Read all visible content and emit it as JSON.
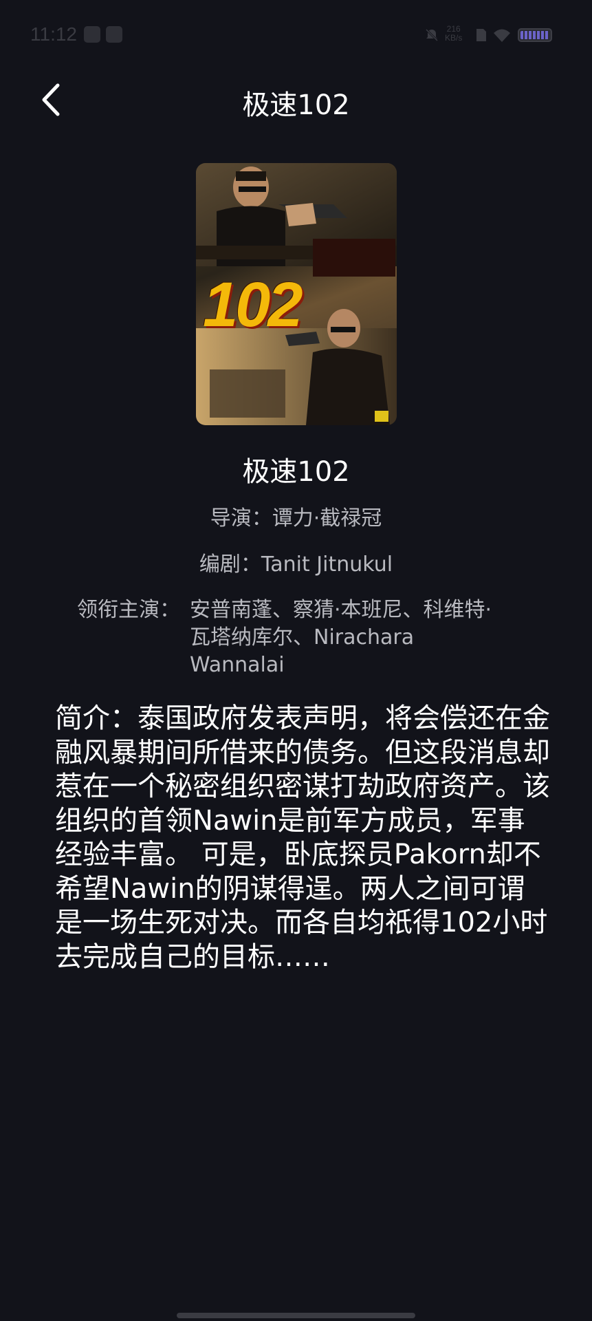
{
  "status_bar": {
    "time": "11:12",
    "net_speed_value": "216",
    "net_speed_unit": "KB/s",
    "left_icons": [
      "notification-icon",
      "app-icon"
    ],
    "right_icons": [
      "mute-icon",
      "network-speed",
      "sim-icon",
      "wifi-icon",
      "battery-icon"
    ]
  },
  "header": {
    "back_icon": "chevron-left-icon",
    "title": "极速102"
  },
  "poster": {
    "number_text": "102"
  },
  "movie": {
    "title": "极速102",
    "director": "导演：谭力·截禄冠",
    "writer": "编剧：Tanit Jitnukul",
    "cast_label": "领衔主演：",
    "cast_value": "安普南蓬、察猜·本班尼、科维特·瓦塔纳库尔、Nirachara Wannalai",
    "synopsis": "简介：泰国政府发表声明，将会偿还在金融风暴期间所借来的债务。但这段消息却惹在一个秘密组织密谋打劫政府资产。该组织的首领Nawin是前军方成员，军事经验丰富。 可是，卧底探员Pakorn却不希望Nawin的阴谋得逞。两人之间可谓是一场生死对决。而各自均祇得102小时去完成自己的目标……"
  },
  "colors": {
    "background": "#12131a",
    "text_primary": "#ffffff",
    "text_secondary": "#b9bac0"
  }
}
